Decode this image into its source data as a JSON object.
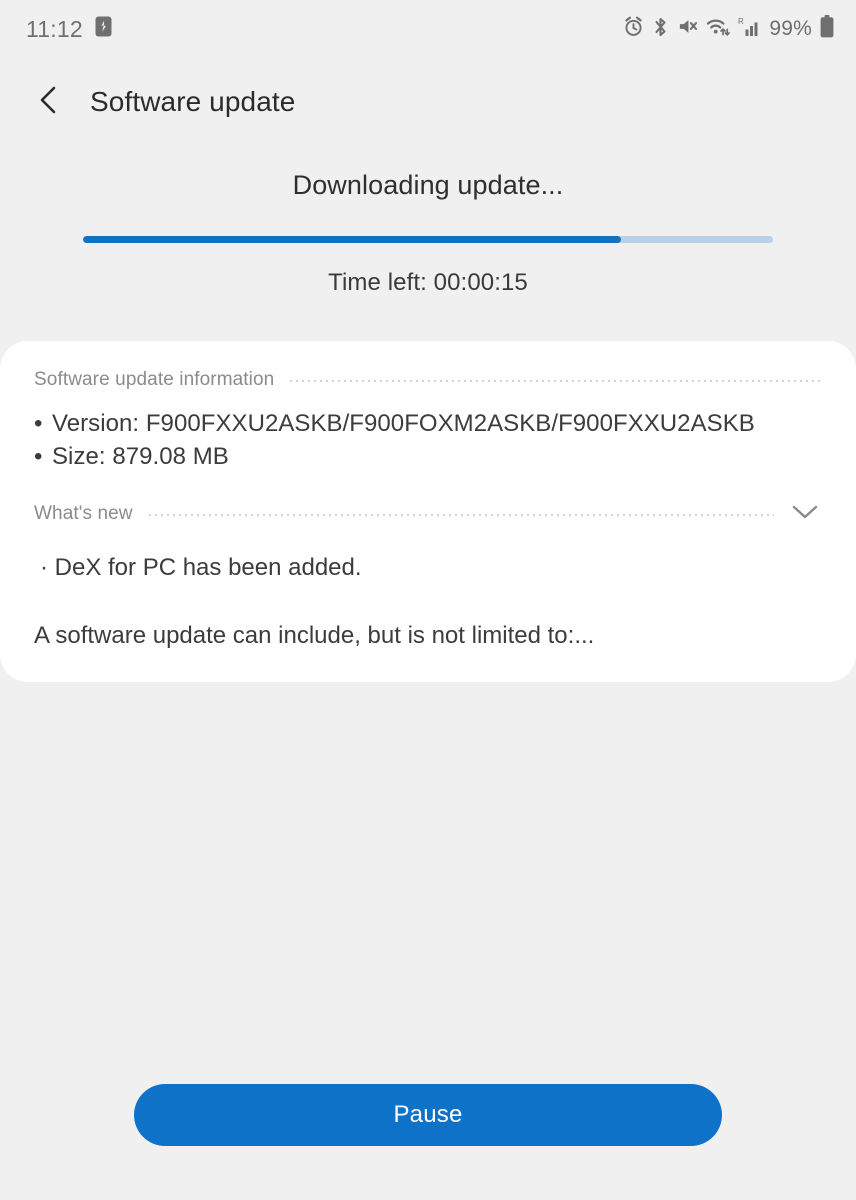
{
  "status_bar": {
    "time": "11:12",
    "left_icons": [
      {
        "name": "sd-card-icon",
        "glyph": "sd"
      }
    ],
    "right_icons": [
      {
        "name": "alarm-icon"
      },
      {
        "name": "bluetooth-icon"
      },
      {
        "name": "volume-mute-icon"
      },
      {
        "name": "wifi-icon"
      },
      {
        "name": "cellular-signal-roaming-icon",
        "badge": "R"
      }
    ],
    "battery_percent": "99%",
    "battery_icon": "battery-full-icon"
  },
  "header": {
    "back_icon": "chevron-left-icon",
    "title": "Software update"
  },
  "progress": {
    "status_text": "Downloading update...",
    "percent": 78,
    "percent_css": "78%",
    "time_left_label": "Time left: 00:00:15",
    "fill_color": "#1272c0",
    "track_color": "#b9d0e8"
  },
  "info_card": {
    "update_info": {
      "section_label": "Software update information",
      "items": [
        {
          "bullet": "•",
          "text": "Version: F900FXXU2ASKB/F900FOXM2ASKB/F900FXXU2ASKB"
        },
        {
          "bullet": "•",
          "text": "Size: 879.08 MB"
        }
      ]
    },
    "whats_new": {
      "section_label": "What's new",
      "toggle_icon": "chevron-down-icon",
      "items": [
        "· DeX for PC has been added."
      ],
      "note": "A software update can include, but is not limited to:..."
    }
  },
  "bottom": {
    "action_label": "Pause",
    "accent_color": "#0e72c8"
  }
}
